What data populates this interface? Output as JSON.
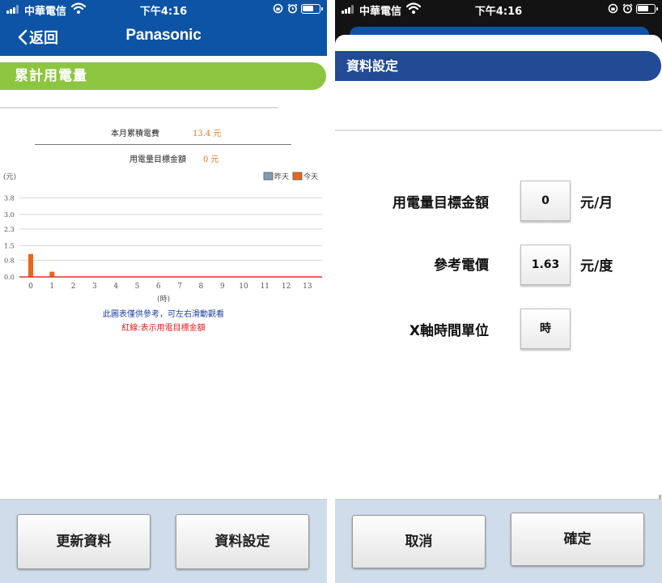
{
  "status_bar": {
    "carrier": "中華電信",
    "time": "下午4:16"
  },
  "left_screen": {
    "header": {
      "back_label": "返回",
      "brand": "Panasonic"
    },
    "section_title": "累計用電量",
    "summary": {
      "monthly_label": "本月累積電費",
      "monthly_value": "13.4 元",
      "target_label": "用電量目標金額",
      "target_value": "0 元"
    },
    "chart_data": {
      "type": "bar",
      "ylabel": "(元)",
      "xlabel": "(時)",
      "x": [
        0,
        1,
        2,
        3,
        4,
        5,
        6,
        7,
        8,
        9,
        10,
        11,
        12,
        13
      ],
      "x_tick_labels": [
        "0",
        "1",
        "2",
        "3",
        "4",
        "5",
        "6",
        "7",
        "8",
        "9",
        "10",
        "11",
        "12",
        "13"
      ],
      "y_tick_labels": [
        "0.0",
        "0.8",
        "1.5",
        "2.3",
        "3.0",
        "3.8"
      ],
      "ylim": [
        0,
        4.2
      ],
      "grid": true,
      "legend_position": "top-right",
      "target_line": 0,
      "series": [
        {
          "name": "昨天",
          "color": "#7f9db9",
          "values": [
            0,
            0,
            0,
            0,
            0,
            0,
            0,
            0,
            0,
            0,
            0,
            0,
            0,
            0
          ]
        },
        {
          "name": "今天",
          "color": "#e8661e",
          "values": [
            1.1,
            0.25,
            0,
            0,
            0,
            0,
            0,
            0,
            0,
            0,
            0,
            0,
            0,
            0
          ]
        }
      ],
      "colors": {
        "grid": "#d6d6d6",
        "target_line": "#e03030",
        "text": "#555555"
      }
    },
    "notes": {
      "scroll_hint": "此圖表僅供參考，可左右滑動觀看",
      "red_line_hint": "紅線:表示用電目標金額"
    },
    "buttons": {
      "refresh": "更新資料",
      "settings": "資料設定"
    }
  },
  "right_screen": {
    "dialog_title": "資料設定",
    "fields": [
      {
        "label": "用電量目標金額",
        "value": "0",
        "unit": "元/月"
      },
      {
        "label": "參考電價",
        "value": "1.63",
        "unit": "元/度"
      },
      {
        "label": "X軸時間單位",
        "value": "時",
        "unit": ""
      }
    ],
    "buttons": {
      "cancel": "取消",
      "confirm": "確定"
    }
  },
  "colors": {
    "header_blue": "#0d53a6",
    "section_green": "#8cc63e",
    "dialog_title_blue": "#224a95",
    "bottom_bar": "#cfdcea",
    "accent_orange": "#e07b24"
  },
  "icons": [
    "signal-icon",
    "wifi-icon",
    "rotation-lock-icon",
    "alarm-icon",
    "battery-icon",
    "chevron-left-icon"
  ]
}
